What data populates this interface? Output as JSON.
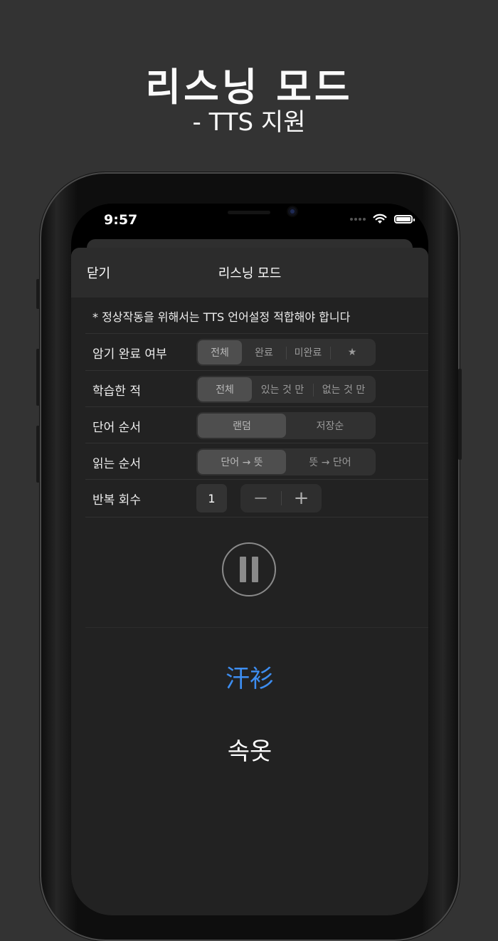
{
  "promo": {
    "title": "리스닝 모드",
    "subtitle": "- TTS 지원"
  },
  "status_bar": {
    "time": "9:57",
    "icons": [
      "cellular-dots-icon",
      "wifi-icon",
      "battery-icon"
    ]
  },
  "sheet": {
    "close_label": "닫기",
    "title": "리스닝 모드",
    "notice": "* 정상작동을 위해서는 TTS 언어설정 적합해야 합니다"
  },
  "settings": [
    {
      "label": "암기 완료 여부",
      "options": [
        "전체",
        "완료",
        "미완료",
        "★"
      ],
      "selected": 0
    },
    {
      "label": "학습한 적",
      "options": [
        "전체",
        "있는 것 만",
        "없는 것 만"
      ],
      "selected": 0
    },
    {
      "label": "단어 순서",
      "options": [
        "랜덤",
        "저장순"
      ],
      "selected": 0
    },
    {
      "label": "읽는 순서",
      "options": [
        "단어 → 뜻",
        "뜻 → 단어"
      ],
      "selected": 0
    }
  ],
  "repeat": {
    "label": "반복 회수",
    "value": "1",
    "minus": "−",
    "plus": "+"
  },
  "player": {
    "state": "playing",
    "control_icon": "pause-icon"
  },
  "card": {
    "word": "汗衫",
    "meaning": "속옷"
  },
  "colors": {
    "background": "#333333",
    "sheet": "#222222",
    "accent": "#3d8ef2"
  }
}
